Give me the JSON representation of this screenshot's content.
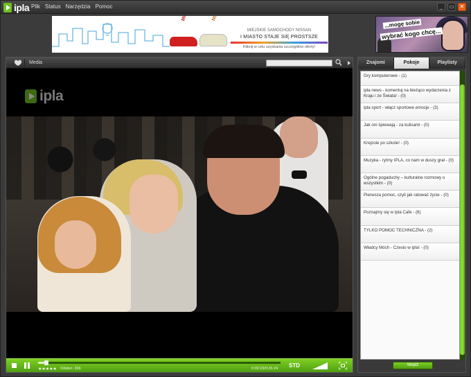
{
  "app": {
    "logo_text": "ipla"
  },
  "menu": [
    {
      "label": "Plik"
    },
    {
      "label": "Status"
    },
    {
      "label": "Narzędzia"
    },
    {
      "label": "Pomoc"
    }
  ],
  "window_buttons": {
    "minimize": "_",
    "maximize": "▭",
    "close": "✕"
  },
  "banner_left": {
    "brand1": "MICRA",
    "brand2": "NOTE",
    "line1": "MIEJSKIE SAMOCHODY NISSAN",
    "line2": "I MIASTO STAJE SIĘ PROSTSZE",
    "line3": "Kliknij w celu uzyskania szczegółów oferty!"
  },
  "banner_right": {
    "line1": "...mogę sobie",
    "line2": "wybrać kogo chcę..."
  },
  "player": {
    "media_label": "Media",
    "search_placeholder": "",
    "watermark": "ipla",
    "progress": 0.035,
    "stars": "★★★★★",
    "views": "Odsłon: 266",
    "time": "0:00:23/0:26:24",
    "quality": "STD"
  },
  "side": {
    "tabs": [
      {
        "label": "Znajomi",
        "active": false
      },
      {
        "label": "Pokoje",
        "active": true
      },
      {
        "label": "Playlisty",
        "active": false
      }
    ],
    "rooms": [
      {
        "label": "Gry komputerowe - (1)"
      },
      {
        "label": "ipla news - komentuj na bieżąco wydarzenia z Kraju i ze Świata! - (0)"
      },
      {
        "label": "ipla sport - włącz sportowe emocje - (3)"
      },
      {
        "label": "Jak oni śpiewają - za kulisami - (0)"
      },
      {
        "label": "Krejzole po szkole! - (0)"
      },
      {
        "label": "Muzyka - rytmy IPLA, co nam w duszy grał - (0)"
      },
      {
        "label": "Ogólne pogaduchy – kulturalne rozmowy o wszystkim - (0)"
      },
      {
        "label": "Pierwsza pomoc, czyli jak ratować życie - (0)"
      },
      {
        "label": "Poznajmy się w Ipla Cafe - (6)"
      },
      {
        "label": "TYLKO POMOC TECHNICZNA - (2)"
      },
      {
        "label": "Władcy Móch - Czesio w ipla! - (0)"
      }
    ],
    "enter_button": "Wejdź"
  },
  "colors": {
    "accent": "#6fbf1f",
    "close": "#e4631c"
  }
}
